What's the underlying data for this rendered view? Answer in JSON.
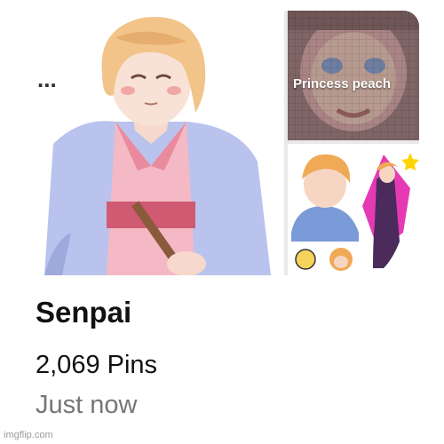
{
  "board": {
    "title": "Senpai",
    "pin_count": "2,069 Pins",
    "updated": "Just now"
  },
  "cover": {
    "main_speech": "...",
    "top_right_caption": "Princess peach"
  },
  "watermark": "imgflip.com",
  "colors": {
    "title_text": "#111111",
    "secondary_text": "#767676",
    "cover_gap": "#e9e9e9"
  }
}
